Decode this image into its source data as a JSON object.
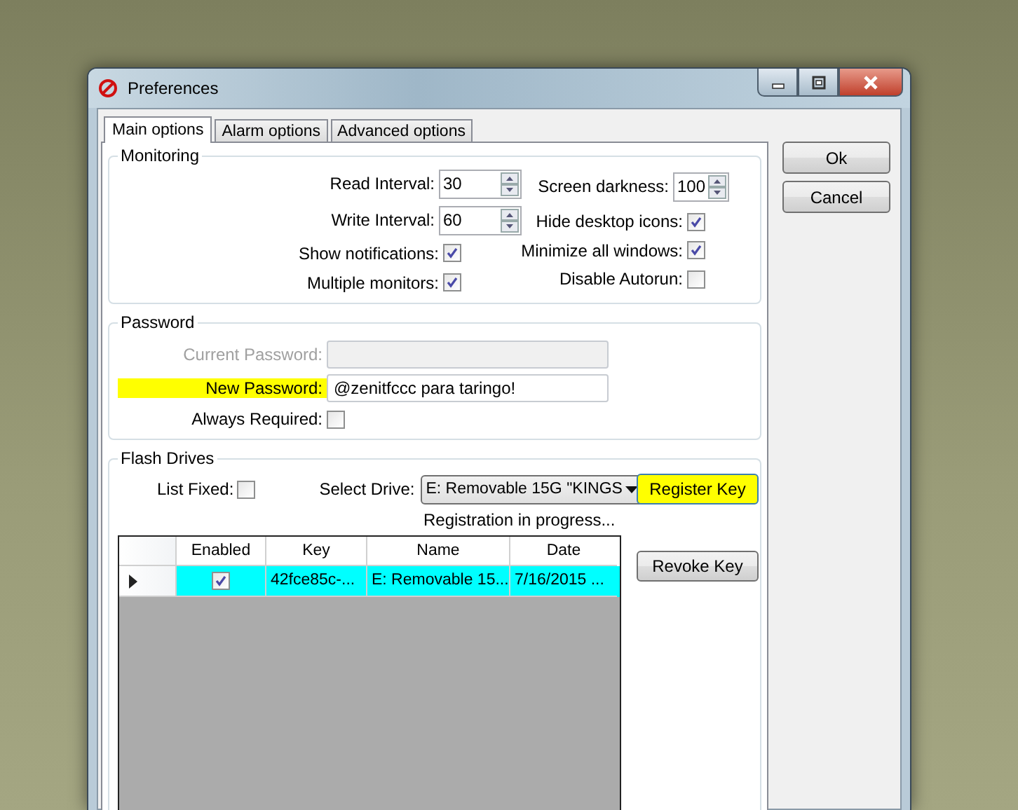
{
  "window": {
    "title": "Preferences"
  },
  "tabs": [
    {
      "label": "Main options",
      "selected": true
    },
    {
      "label": "Alarm options",
      "selected": false
    },
    {
      "label": "Advanced options",
      "selected": false
    }
  ],
  "monitoring": {
    "title": "Monitoring",
    "left": [
      {
        "kind": "spinner",
        "label": "Read Interval:",
        "value": "30"
      },
      {
        "kind": "spinner",
        "label": "Write Interval:",
        "value": "60"
      },
      {
        "kind": "checkbox",
        "label": "Show notifications:",
        "checked": true
      },
      {
        "kind": "checkbox",
        "label": "Multiple monitors:",
        "checked": true
      }
    ],
    "right": [
      {
        "kind": "spinner",
        "label": "Screen darkness:",
        "value": "100"
      },
      {
        "kind": "checkbox",
        "label": "Hide desktop icons:",
        "checked": true
      },
      {
        "kind": "checkbox",
        "label": "Minimize all windows:",
        "checked": true
      },
      {
        "kind": "checkbox",
        "label": "Disable Autorun:",
        "checked": false
      }
    ]
  },
  "password": {
    "title": "Password",
    "rows": [
      {
        "kind": "text",
        "label": "Current Password:",
        "disabled": true,
        "highlighted": false
      },
      {
        "kind": "text",
        "label": "New Password:",
        "value": "@zenitfccc para taringo!",
        "disabled": false,
        "highlighted": true
      },
      {
        "kind": "checkbox",
        "label": "Always Required:",
        "checked": false
      }
    ]
  },
  "flash_drives": {
    "title": "Flash Drives",
    "list_fixed": {
      "label": "List Fixed:",
      "checked": false
    },
    "select_drive": {
      "label": "Select Drive:",
      "value": "E: Removable 15G \"KINGS"
    },
    "status": "Registration in progress...",
    "table": {
      "columns": [
        "Enabled",
        "Key",
        "Name",
        "Date"
      ],
      "rows": [
        {
          "selected": true,
          "enabled": true,
          "key": "42fce85c-...",
          "name": "E: Removable 15...",
          "date": "7/16/2015 ..."
        }
      ]
    }
  },
  "side_buttons": [
    {
      "label": "Register Key",
      "highlighted": true
    },
    {
      "label": "Revoke Key",
      "highlighted": false
    }
  ],
  "dialog_buttons": [
    "Ok",
    "Cancel"
  ]
}
